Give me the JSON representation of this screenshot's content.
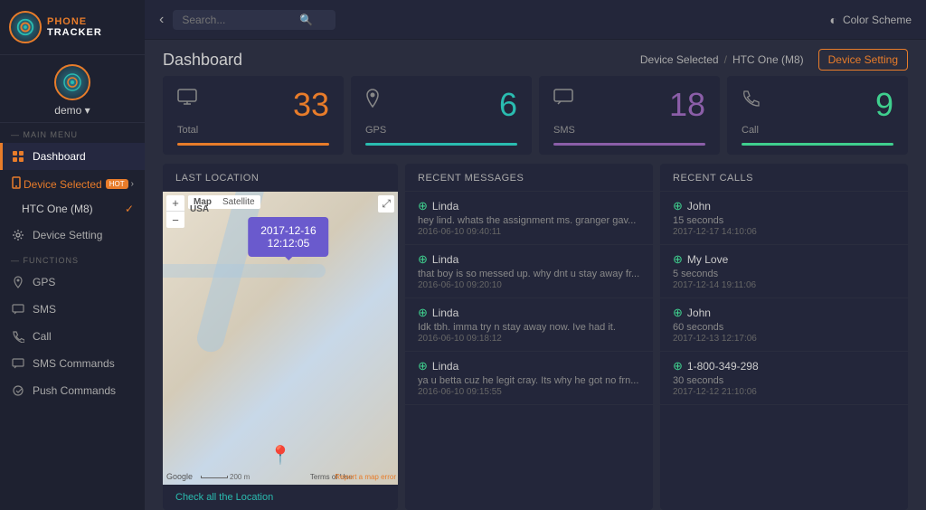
{
  "app": {
    "name": "PHONE TRACKER"
  },
  "topbar": {
    "search_placeholder": "Search...",
    "color_scheme_label": "Color Scheme"
  },
  "sidebar": {
    "user": {
      "name": "demo",
      "dropdown": "▾"
    },
    "main_menu_label": "— MAIN MENU",
    "items": [
      {
        "id": "dashboard",
        "label": "Dashboard",
        "active": true
      },
      {
        "id": "device-selected",
        "label": "Device Selected",
        "badge": "HOT"
      },
      {
        "id": "device-name",
        "label": "HTC One (M8)"
      },
      {
        "id": "device-setting",
        "label": "Device Setting"
      }
    ],
    "functions_label": "— FUNCTIONS",
    "functions": [
      {
        "id": "gps",
        "label": "GPS"
      },
      {
        "id": "sms",
        "label": "SMS"
      },
      {
        "id": "call",
        "label": "Call"
      },
      {
        "id": "sms-commands",
        "label": "SMS Commands"
      },
      {
        "id": "push-commands",
        "label": "Push Commands"
      }
    ]
  },
  "dashboard": {
    "title": "Dashboard",
    "breadcrumb_label": "Device Selected",
    "breadcrumb_sep": "/",
    "breadcrumb_device": "HTC One (M8)",
    "device_setting_btn": "Device Setting"
  },
  "stats": [
    {
      "id": "total",
      "icon": "monitor",
      "label": "Total",
      "value": "33",
      "color": "orange"
    },
    {
      "id": "gps",
      "icon": "location",
      "label": "GPS",
      "value": "6",
      "color": "teal"
    },
    {
      "id": "sms",
      "icon": "sms",
      "label": "SMS",
      "value": "18",
      "color": "purple"
    },
    {
      "id": "call",
      "icon": "call",
      "label": "Call",
      "value": "9",
      "color": "green"
    }
  ],
  "last_location": {
    "title": "LAST LOCATION",
    "map_date": "2017-12-16",
    "map_time": "12:12:05",
    "map_btn_map": "Map",
    "map_btn_satellite": "Satellite",
    "check_all": "Check all the Location",
    "usa_label": "USA"
  },
  "recent_messages": {
    "title": "RECENT MESSAGES",
    "items": [
      {
        "sender": "Linda",
        "text": "hey lind. whats the assignment ms. granger gav...",
        "date": "2016-06-10 09:40:11"
      },
      {
        "sender": "Linda",
        "text": "that boy is so messed up. why dnt u stay away fr...",
        "date": "2016-06-10 09:20:10"
      },
      {
        "sender": "Linda",
        "text": "Idk tbh. imma try n stay away now. Ive had it.",
        "date": "2016-06-10 09:18:12"
      },
      {
        "sender": "Linda",
        "text": "ya u betta cuz he legit cray. Its why he got no frn...",
        "date": "2016-06-10 09:15:55"
      }
    ]
  },
  "recent_calls": {
    "title": "RECENT CALLS",
    "items": [
      {
        "name": "John",
        "duration": "15 seconds",
        "date": "2017-12-17 14:10:06"
      },
      {
        "name": "My Love",
        "duration": "5 seconds",
        "date": "2017-12-14 19:11:06"
      },
      {
        "name": "John",
        "duration": "60 seconds",
        "date": "2017-12-13 12:17:06"
      },
      {
        "name": "1-800-349-298",
        "duration": "30 seconds",
        "date": "2017-12-12 21:10:06"
      }
    ]
  }
}
